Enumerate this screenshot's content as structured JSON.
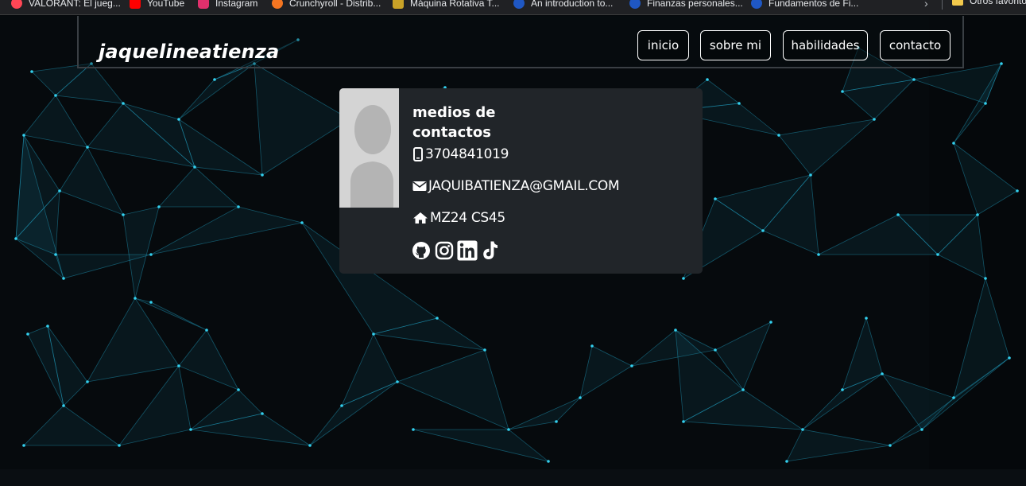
{
  "bookmarks": [
    {
      "label": "VALORANT: El jueg...",
      "color": "#ff4655"
    },
    {
      "label": "YouTube",
      "color": "#ff0000"
    },
    {
      "label": "Instagram",
      "color": "#e1306c"
    },
    {
      "label": "Crunchyroll - Distrib...",
      "color": "#f47521"
    },
    {
      "label": "Máquina Rotativa T...",
      "color": "#c9a227"
    },
    {
      "label": "An introduction to...",
      "color": "#1f57c3"
    },
    {
      "label": "Finanzas personales...",
      "color": "#1f57c3"
    },
    {
      "label": "Fundamentos de Fi...",
      "color": "#1f57c3"
    }
  ],
  "bookmarks_other": "Otros favoritos",
  "nav": {
    "brand": "jaquelineatienza",
    "links": [
      "inicio",
      "sobre mi",
      "habilidades",
      "contacto"
    ]
  },
  "contact_card": {
    "title_line1": "medios de",
    "title_line2": "contactos",
    "phone": "3704841019",
    "email": "JAQUIBATIENZA@GMAIL.COM",
    "address": "MZ24 CS45",
    "socials": [
      "github-icon",
      "instagram-icon",
      "linkedin-icon",
      "tiktok-icon"
    ]
  },
  "colors": {
    "card_bg": "#212529",
    "accent_network": "#1fb6d6",
    "page_bg": "#05080b"
  }
}
